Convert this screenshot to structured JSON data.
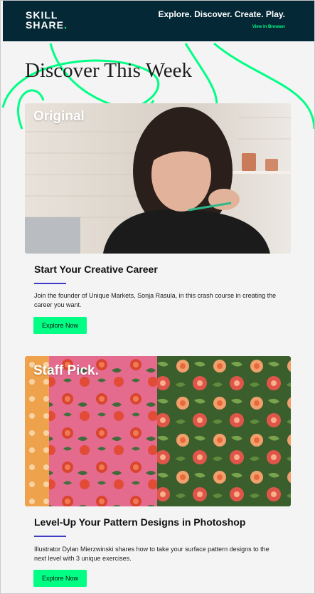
{
  "header": {
    "logo_line1": "SKILL",
    "logo_line2": "SHARE",
    "logo_dot": ".",
    "tagline": "Explore. Discover. Create. Play.",
    "view_in_browser": "View in Browser"
  },
  "colors": {
    "header_bg": "#042836",
    "accent_green": "#00ff84",
    "rule_purple": "#3f3cc8"
  },
  "headline": "Discover This Week",
  "cards": [
    {
      "badge": "Original",
      "title": "Start Your Creative Career",
      "description": "Join the founder of Unique Markets, Sonja Rasula, in this crash course in creating the career you want.",
      "button": "Explore Now",
      "image": "photo-woman-creative-career"
    },
    {
      "badge": "Staff Pick.",
      "title": "Level-Up Your Pattern Designs in Photoshop",
      "description": "Illustrator Dylan Mierzwinski shares how to take your surface pattern designs to the next level with 3 unique exercises.",
      "button": "Explore Now",
      "image": "floral-pattern-design"
    }
  ]
}
